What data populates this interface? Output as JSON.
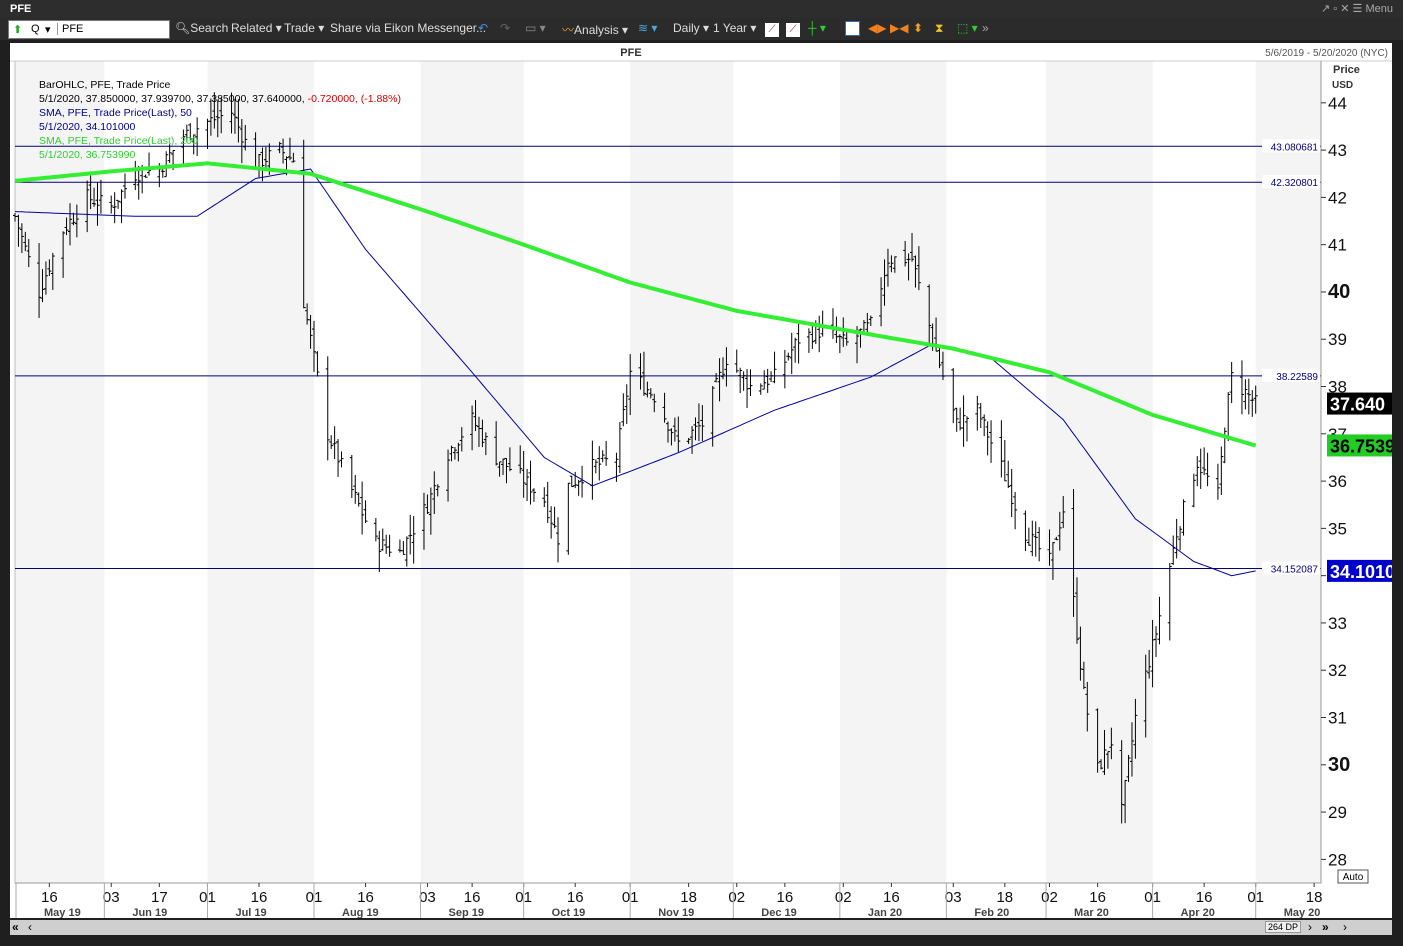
{
  "window": {
    "title": "PFE",
    "menu_label": "Menu"
  },
  "toolbar": {
    "ric_prefix": "Q",
    "ric_value": "PFE",
    "search": "Search",
    "related": "Related",
    "trade": "Trade",
    "share": "Share via Eikon Messenger...",
    "analysis": "Analysis",
    "interval": "Daily",
    "range": "1 Year"
  },
  "chart_header": {
    "title": "PFE",
    "date_range": "5/6/2019 - 5/20/2020 (NYC)"
  },
  "legend": [
    {
      "text": "BarOHLC, PFE, Trade Price",
      "color": "#000000"
    },
    {
      "text": "5/1/2020, 37.850000, 37.939700, 37.385000, 37.640000, ",
      "color": "#000000",
      "extra": "-0.720000, (-1.88%)",
      "extra_color": "#d40000"
    },
    {
      "text": "SMA, PFE, Trade Price(Last), 50",
      "color": "#00008b"
    },
    {
      "text": "5/1/2020, 34.101000",
      "color": "#00008b"
    },
    {
      "text": "SMA, PFE, Trade Price(Last), 200",
      "color": "#33cc33"
    },
    {
      "text": "5/1/2020, 36.753990",
      "color": "#33cc33"
    }
  ],
  "axis": {
    "y_title_1": "Price",
    "y_title_2": "USD",
    "auto_label": "Auto",
    "dp_label": "264 DP"
  },
  "colors": {
    "price_bars": "#000000",
    "sma50": "#0000a0",
    "sma200": "#33ee33",
    "hline": "#000080",
    "last_price_bg": "#000000",
    "sma200_badge_bg": "#22cc22",
    "sma50_badge_bg": "#0000cc"
  },
  "chart_data": {
    "type": "bar",
    "subtype": "ohlc",
    "title": "PFE",
    "ylabel": "Price USD",
    "ylim": [
      27.5,
      44.8
    ],
    "y_ticks": [
      28,
      29,
      30,
      31,
      32,
      33,
      34,
      35,
      36,
      37,
      38,
      39,
      40,
      41,
      42,
      43,
      44
    ],
    "y_bold_ticks": [
      30,
      40
    ],
    "x_day_ticks": [
      "16",
      "03",
      "17",
      "01",
      "16",
      "01",
      "16",
      "03",
      "16",
      "01",
      "16",
      "01",
      "18",
      "02",
      "16",
      "02",
      "16",
      "03",
      "18",
      "02",
      "16",
      "01",
      "16",
      "01",
      "18"
    ],
    "x_month_labels": [
      "May 19",
      "Jun 19",
      "Jul 19",
      "Aug 19",
      "Sep 19",
      "Oct 19",
      "Nov 19",
      "Dec 19",
      "Jan 20",
      "Feb 20",
      "Mar 20",
      "Apr 20",
      "May 20"
    ],
    "horizontal_lines": [
      {
        "value": 43.080681,
        "label": "43.080681"
      },
      {
        "value": 42.320801,
        "label": "42.320801"
      },
      {
        "value": 38.22589,
        "label": "38.22589"
      },
      {
        "value": 34.152087,
        "label": "34.152087"
      }
    ],
    "last_price": {
      "value": 37.64,
      "label": "37.640"
    },
    "sma200_last": {
      "value": 36.75399,
      "label": "36.7539"
    },
    "sma50_last": {
      "value": 34.101,
      "label": "34.1010"
    },
    "close_anchors": [
      [
        "2019-05-06",
        41.6
      ],
      [
        "2019-05-13",
        40.0
      ],
      [
        "2019-05-20",
        41.3
      ],
      [
        "2019-05-27",
        42.0
      ],
      [
        "2019-06-03",
        41.8
      ],
      [
        "2019-06-10",
        42.5
      ],
      [
        "2019-06-17",
        42.6
      ],
      [
        "2019-06-24",
        43.3
      ],
      [
        "2019-07-01",
        43.6
      ],
      [
        "2019-07-08",
        43.8
      ],
      [
        "2019-07-15",
        42.7
      ],
      [
        "2019-07-22",
        43.0
      ],
      [
        "2019-07-26",
        42.8
      ],
      [
        "2019-07-29",
        39.8
      ],
      [
        "2019-08-05",
        37.0
      ],
      [
        "2019-08-12",
        35.8
      ],
      [
        "2019-08-19",
        34.7
      ],
      [
        "2019-08-26",
        34.5
      ],
      [
        "2019-09-03",
        35.5
      ],
      [
        "2019-09-09",
        36.6
      ],
      [
        "2019-09-16",
        37.3
      ],
      [
        "2019-09-23",
        36.5
      ],
      [
        "2019-09-30",
        36.1
      ],
      [
        "2019-10-07",
        35.6
      ],
      [
        "2019-10-11",
        34.8
      ],
      [
        "2019-10-14",
        35.9
      ],
      [
        "2019-10-21",
        36.3
      ],
      [
        "2019-10-28",
        36.5
      ],
      [
        "2019-11-01",
        38.3
      ],
      [
        "2019-11-08",
        37.8
      ],
      [
        "2019-11-15",
        36.8
      ],
      [
        "2019-11-22",
        37.2
      ],
      [
        "2019-11-29",
        38.6
      ],
      [
        "2019-12-06",
        38.0
      ],
      [
        "2019-12-13",
        38.2
      ],
      [
        "2019-12-20",
        39.0
      ],
      [
        "2019-12-27",
        39.2
      ],
      [
        "2020-01-03",
        38.9
      ],
      [
        "2020-01-10",
        39.3
      ],
      [
        "2020-01-15",
        40.7
      ],
      [
        "2020-01-22",
        40.7
      ],
      [
        "2020-01-28",
        39.0
      ],
      [
        "2020-02-04",
        37.2
      ],
      [
        "2020-02-10",
        37.5
      ],
      [
        "2020-02-17",
        36.3
      ],
      [
        "2020-02-24",
        34.9
      ],
      [
        "2020-03-02",
        34.3
      ],
      [
        "2020-03-06",
        35.4
      ],
      [
        "2020-03-12",
        31.5
      ],
      [
        "2020-03-16",
        29.9
      ],
      [
        "2020-03-20",
        30.5
      ],
      [
        "2020-03-23",
        29.0
      ],
      [
        "2020-03-27",
        31.0
      ],
      [
        "2020-04-02",
        32.8
      ],
      [
        "2020-04-08",
        34.9
      ],
      [
        "2020-04-14",
        36.4
      ],
      [
        "2020-04-20",
        35.7
      ],
      [
        "2020-04-22",
        37.2
      ],
      [
        "2020-04-24",
        38.2
      ],
      [
        "2020-05-01",
        37.64
      ]
    ],
    "sma50_anchors": [
      [
        "2019-05-06",
        41.7
      ],
      [
        "2019-06-10",
        41.6
      ],
      [
        "2019-06-28",
        41.6
      ],
      [
        "2019-07-15",
        42.4
      ],
      [
        "2019-07-31",
        42.6
      ],
      [
        "2019-08-16",
        40.9
      ],
      [
        "2019-09-16",
        38.3
      ],
      [
        "2019-10-07",
        36.5
      ],
      [
        "2019-10-21",
        35.9
      ],
      [
        "2019-11-15",
        36.6
      ],
      [
        "2019-12-13",
        37.5
      ],
      [
        "2020-01-10",
        38.2
      ],
      [
        "2020-01-28",
        38.9
      ],
      [
        "2020-02-14",
        38.6
      ],
      [
        "2020-03-06",
        37.3
      ],
      [
        "2020-03-27",
        35.2
      ],
      [
        "2020-04-13",
        34.3
      ],
      [
        "2020-04-24",
        34.0
      ],
      [
        "2020-05-01",
        34.1
      ]
    ],
    "sma200_anchors": [
      [
        "2019-05-06",
        42.35
      ],
      [
        "2019-06-03",
        42.55
      ],
      [
        "2019-07-01",
        42.72
      ],
      [
        "2019-07-31",
        42.5
      ],
      [
        "2019-09-03",
        41.7
      ],
      [
        "2019-10-01",
        41.0
      ],
      [
        "2019-11-01",
        40.2
      ],
      [
        "2019-12-02",
        39.6
      ],
      [
        "2020-01-02",
        39.2
      ],
      [
        "2020-02-03",
        38.8
      ],
      [
        "2020-03-02",
        38.3
      ],
      [
        "2020-04-01",
        37.4
      ],
      [
        "2020-05-01",
        36.75
      ]
    ]
  }
}
